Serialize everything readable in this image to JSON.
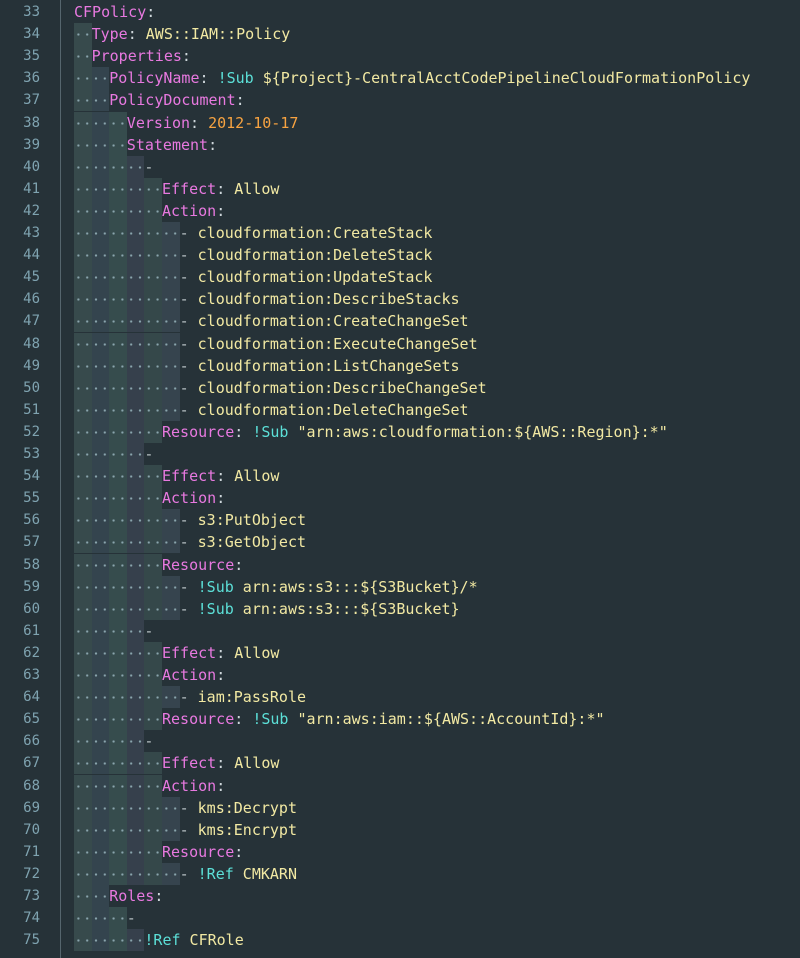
{
  "editor": {
    "lines": [
      {
        "n": "33",
        "indent": 0,
        "tokens": [
          {
            "c": "k",
            "t": "CFPolicy"
          },
          {
            "c": "p",
            "t": ":"
          }
        ]
      },
      {
        "n": "34",
        "indent": 2,
        "tokens": [
          {
            "c": "k",
            "t": "Type"
          },
          {
            "c": "p",
            "t": ": "
          },
          {
            "c": "t",
            "t": "AWS::IAM::Policy"
          }
        ]
      },
      {
        "n": "35",
        "indent": 2,
        "tokens": [
          {
            "c": "k",
            "t": "Properties"
          },
          {
            "c": "p",
            "t": ":"
          }
        ]
      },
      {
        "n": "36",
        "indent": 4,
        "tokens": [
          {
            "c": "k",
            "t": "PolicyName"
          },
          {
            "c": "p",
            "t": ": "
          },
          {
            "c": "tag",
            "t": "!Sub"
          },
          {
            "c": "t",
            "t": " ${Project}-CentralAcctCodePipelineCloudFormationPolicy"
          }
        ]
      },
      {
        "n": "37",
        "indent": 4,
        "tokens": [
          {
            "c": "k",
            "t": "PolicyDocument"
          },
          {
            "c": "p",
            "t": ":"
          }
        ]
      },
      {
        "n": "38",
        "indent": 6,
        "tokens": [
          {
            "c": "k",
            "t": "Version"
          },
          {
            "c": "p",
            "t": ": "
          },
          {
            "c": "num",
            "t": "2012-10-17"
          }
        ]
      },
      {
        "n": "39",
        "indent": 6,
        "tokens": [
          {
            "c": "k",
            "t": "Statement"
          },
          {
            "c": "p",
            "t": ":"
          }
        ]
      },
      {
        "n": "40",
        "indent": 8,
        "tokens": [
          {
            "c": "dash",
            "t": "-"
          }
        ]
      },
      {
        "n": "41",
        "indent": 10,
        "tokens": [
          {
            "c": "k",
            "t": "Effect"
          },
          {
            "c": "p",
            "t": ": "
          },
          {
            "c": "t",
            "t": "Allow"
          }
        ]
      },
      {
        "n": "42",
        "indent": 10,
        "tokens": [
          {
            "c": "k",
            "t": "Action"
          },
          {
            "c": "p",
            "t": ":"
          }
        ]
      },
      {
        "n": "43",
        "indent": 12,
        "tokens": [
          {
            "c": "dash",
            "t": "- "
          },
          {
            "c": "t",
            "t": "cloudformation:CreateStack"
          }
        ]
      },
      {
        "n": "44",
        "indent": 12,
        "tokens": [
          {
            "c": "dash",
            "t": "- "
          },
          {
            "c": "t",
            "t": "cloudformation:DeleteStack"
          }
        ]
      },
      {
        "n": "45",
        "indent": 12,
        "tokens": [
          {
            "c": "dash",
            "t": "- "
          },
          {
            "c": "t",
            "t": "cloudformation:UpdateStack"
          }
        ]
      },
      {
        "n": "46",
        "indent": 12,
        "tokens": [
          {
            "c": "dash",
            "t": "- "
          },
          {
            "c": "t",
            "t": "cloudformation:DescribeStacks"
          }
        ]
      },
      {
        "n": "47",
        "indent": 12,
        "tokens": [
          {
            "c": "dash",
            "t": "- "
          },
          {
            "c": "t",
            "t": "cloudformation:CreateChangeSet"
          }
        ]
      },
      {
        "n": "48",
        "indent": 12,
        "tokens": [
          {
            "c": "dash",
            "t": "- "
          },
          {
            "c": "t",
            "t": "cloudformation:ExecuteChangeSet"
          }
        ]
      },
      {
        "n": "49",
        "indent": 12,
        "tokens": [
          {
            "c": "dash",
            "t": "- "
          },
          {
            "c": "t",
            "t": "cloudformation:ListChangeSets"
          }
        ]
      },
      {
        "n": "50",
        "indent": 12,
        "tokens": [
          {
            "c": "dash",
            "t": "- "
          },
          {
            "c": "t",
            "t": "cloudformation:DescribeChangeSet"
          }
        ]
      },
      {
        "n": "51",
        "indent": 12,
        "tokens": [
          {
            "c": "dash",
            "t": "- "
          },
          {
            "c": "t",
            "t": "cloudformation:DeleteChangeSet"
          }
        ]
      },
      {
        "n": "52",
        "indent": 10,
        "tokens": [
          {
            "c": "k",
            "t": "Resource"
          },
          {
            "c": "p",
            "t": ": "
          },
          {
            "c": "tag",
            "t": "!Sub"
          },
          {
            "c": "t",
            "t": " \"arn:aws:cloudformation:${AWS::Region}:*\""
          }
        ]
      },
      {
        "n": "53",
        "indent": 8,
        "tokens": [
          {
            "c": "dash",
            "t": "-"
          }
        ]
      },
      {
        "n": "54",
        "indent": 10,
        "tokens": [
          {
            "c": "k",
            "t": "Effect"
          },
          {
            "c": "p",
            "t": ": "
          },
          {
            "c": "t",
            "t": "Allow"
          }
        ]
      },
      {
        "n": "55",
        "indent": 10,
        "tokens": [
          {
            "c": "k",
            "t": "Action"
          },
          {
            "c": "p",
            "t": ":"
          }
        ]
      },
      {
        "n": "56",
        "indent": 12,
        "tokens": [
          {
            "c": "dash",
            "t": "- "
          },
          {
            "c": "t",
            "t": "s3:PutObject"
          }
        ]
      },
      {
        "n": "57",
        "indent": 12,
        "tokens": [
          {
            "c": "dash",
            "t": "- "
          },
          {
            "c": "t",
            "t": "s3:GetObject"
          }
        ]
      },
      {
        "n": "58",
        "indent": 10,
        "tokens": [
          {
            "c": "k",
            "t": "Resource"
          },
          {
            "c": "p",
            "t": ":"
          }
        ]
      },
      {
        "n": "59",
        "indent": 12,
        "tokens": [
          {
            "c": "dash",
            "t": "- "
          },
          {
            "c": "tag",
            "t": "!Sub"
          },
          {
            "c": "t",
            "t": " arn:aws:s3:::${S3Bucket}/*"
          }
        ]
      },
      {
        "n": "60",
        "indent": 12,
        "tokens": [
          {
            "c": "dash",
            "t": "- "
          },
          {
            "c": "tag",
            "t": "!Sub"
          },
          {
            "c": "t",
            "t": " arn:aws:s3:::${S3Bucket}"
          }
        ]
      },
      {
        "n": "61",
        "indent": 8,
        "tokens": [
          {
            "c": "dash",
            "t": "-"
          }
        ]
      },
      {
        "n": "62",
        "indent": 10,
        "tokens": [
          {
            "c": "k",
            "t": "Effect"
          },
          {
            "c": "p",
            "t": ": "
          },
          {
            "c": "t",
            "t": "Allow"
          }
        ]
      },
      {
        "n": "63",
        "indent": 10,
        "tokens": [
          {
            "c": "k",
            "t": "Action"
          },
          {
            "c": "p",
            "t": ":"
          }
        ]
      },
      {
        "n": "64",
        "indent": 12,
        "tokens": [
          {
            "c": "dash",
            "t": "- "
          },
          {
            "c": "t",
            "t": "iam:PassRole"
          }
        ]
      },
      {
        "n": "65",
        "indent": 10,
        "tokens": [
          {
            "c": "k",
            "t": "Resource"
          },
          {
            "c": "p",
            "t": ": "
          },
          {
            "c": "tag",
            "t": "!Sub"
          },
          {
            "c": "t",
            "t": " \"arn:aws:iam::${AWS::AccountId}:*\""
          }
        ]
      },
      {
        "n": "66",
        "indent": 8,
        "tokens": [
          {
            "c": "dash",
            "t": "-"
          }
        ]
      },
      {
        "n": "67",
        "indent": 10,
        "tokens": [
          {
            "c": "k",
            "t": "Effect"
          },
          {
            "c": "p",
            "t": ": "
          },
          {
            "c": "t",
            "t": "Allow"
          }
        ]
      },
      {
        "n": "68",
        "indent": 10,
        "tokens": [
          {
            "c": "k",
            "t": "Action"
          },
          {
            "c": "p",
            "t": ":"
          }
        ]
      },
      {
        "n": "69",
        "indent": 12,
        "tokens": [
          {
            "c": "dash",
            "t": "- "
          },
          {
            "c": "t",
            "t": "kms:Decrypt"
          }
        ]
      },
      {
        "n": "70",
        "indent": 12,
        "tokens": [
          {
            "c": "dash",
            "t": "- "
          },
          {
            "c": "t",
            "t": "kms:Encrypt"
          }
        ]
      },
      {
        "n": "71",
        "indent": 10,
        "tokens": [
          {
            "c": "k",
            "t": "Resource"
          },
          {
            "c": "p",
            "t": ":"
          }
        ]
      },
      {
        "n": "72",
        "indent": 12,
        "tokens": [
          {
            "c": "dash",
            "t": "- "
          },
          {
            "c": "tag",
            "t": "!Ref"
          },
          {
            "c": "t",
            "t": " CMKARN"
          }
        ]
      },
      {
        "n": "73",
        "indent": 4,
        "tokens": [
          {
            "c": "k",
            "t": "Roles"
          },
          {
            "c": "p",
            "t": ":"
          }
        ]
      },
      {
        "n": "74",
        "indent": 6,
        "tokens": [
          {
            "c": "dash",
            "t": "-"
          }
        ]
      },
      {
        "n": "75",
        "indent": 8,
        "tokens": [
          {
            "c": "tag",
            "t": "!Ref"
          },
          {
            "c": "t",
            "t": " CFRole"
          }
        ]
      }
    ]
  }
}
